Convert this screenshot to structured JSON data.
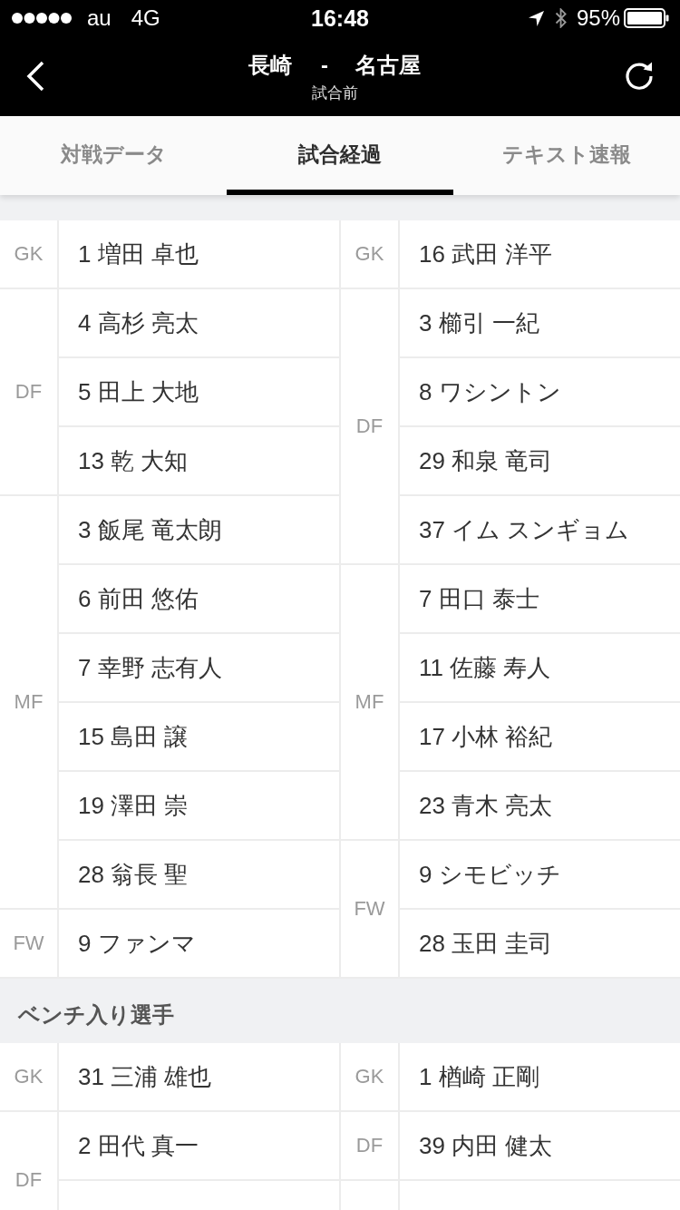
{
  "status_bar": {
    "carrier": "au",
    "network": "4G",
    "time": "16:48",
    "battery": "95%"
  },
  "header": {
    "home": "長崎",
    "separator": "-",
    "away": "名古屋",
    "status": "試合前"
  },
  "tabs": [
    {
      "label": "対戦データ",
      "selected": false
    },
    {
      "label": "試合経過",
      "selected": true
    },
    {
      "label": "テキスト速報",
      "selected": false
    }
  ],
  "sections": [
    {
      "left": [
        {
          "position": "GK",
          "players": [
            "1 増田 卓也"
          ]
        },
        {
          "position": "DF",
          "players": [
            "4 高杉 亮太",
            "5 田上 大地",
            "13 乾 大知"
          ]
        },
        {
          "position": "MF",
          "players": [
            "3 飯尾 竜太朗",
            "6 前田 悠佑",
            "7 幸野 志有人",
            "15 島田 譲",
            "19 澤田 崇",
            "28 翁長 聖"
          ]
        },
        {
          "position": "FW",
          "players": [
            "9 ファンマ"
          ]
        }
      ],
      "right": [
        {
          "position": "GK",
          "players": [
            "16 武田 洋平"
          ]
        },
        {
          "position": "DF",
          "players": [
            "3 櫛引 一紀",
            "8 ワシントン",
            "29 和泉 竜司",
            "37 イム スンギョム"
          ]
        },
        {
          "position": "MF",
          "players": [
            "7 田口 泰士",
            "11 佐藤 寿人",
            "17 小林 裕紀",
            "23 青木 亮太"
          ]
        },
        {
          "position": "FW",
          "players": [
            "9 シモビッチ",
            "28 玉田 圭司"
          ]
        }
      ]
    },
    {
      "title": "ベンチ入り選手",
      "left": [
        {
          "position": "GK",
          "players": [
            "31 三浦 雄也"
          ]
        },
        {
          "position": "DF",
          "players": [
            "2 田代 真一"
          ],
          "continues": true
        }
      ],
      "right": [
        {
          "position": "GK",
          "players": [
            "1 楢崎 正剛"
          ]
        },
        {
          "position": "DF",
          "players": [
            "39 内田 健太"
          ]
        },
        {
          "continues": true
        }
      ]
    }
  ]
}
